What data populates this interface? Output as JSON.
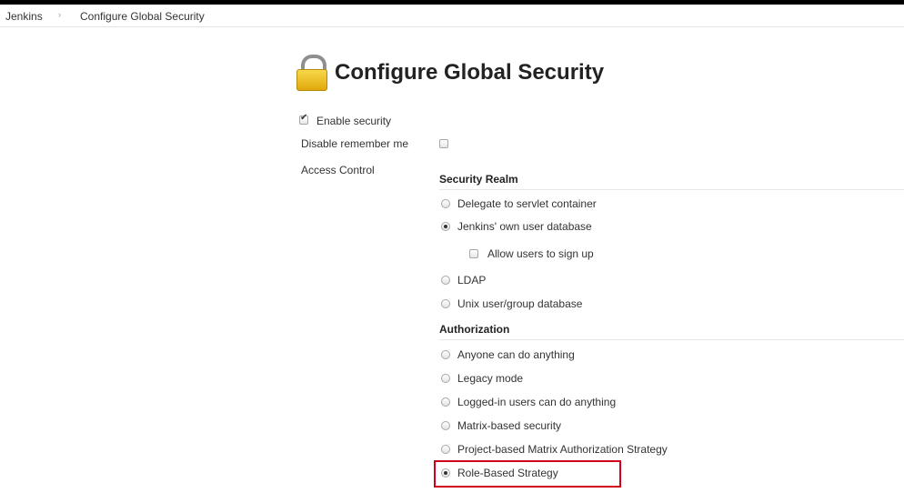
{
  "breadcrumb": {
    "home": "Jenkins",
    "separator": "›",
    "current": "Configure Global Security"
  },
  "page": {
    "title": "Configure Global Security",
    "title_icon": "lock-icon"
  },
  "settings": {
    "enable_security": {
      "label": "Enable security",
      "checked": true
    },
    "disable_remember_me": {
      "label": "Disable remember me",
      "checked": false
    },
    "access_control_label": "Access Control"
  },
  "security_realm": {
    "header": "Security Realm",
    "options": [
      {
        "label": "Delegate to servlet container",
        "selected": false
      },
      {
        "label": "Jenkins' own user database",
        "selected": true
      },
      {
        "label": "LDAP",
        "selected": false
      },
      {
        "label": "Unix user/group database",
        "selected": false
      }
    ],
    "allow_signup": {
      "label": "Allow users to sign up",
      "checked": false
    }
  },
  "authorization": {
    "header": "Authorization",
    "options": [
      {
        "label": "Anyone can do anything",
        "selected": false
      },
      {
        "label": "Legacy mode",
        "selected": false
      },
      {
        "label": "Logged-in users can do anything",
        "selected": false
      },
      {
        "label": "Matrix-based security",
        "selected": false
      },
      {
        "label": "Project-based Matrix Authorization Strategy",
        "selected": false
      },
      {
        "label": "Role-Based Strategy",
        "selected": true
      }
    ]
  },
  "colors": {
    "highlight": "#d0021b",
    "lock_body": "#f2c62b"
  }
}
